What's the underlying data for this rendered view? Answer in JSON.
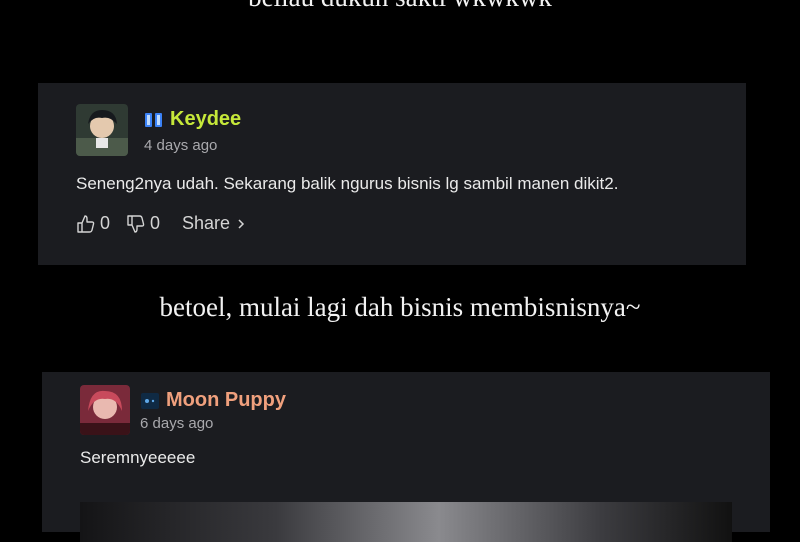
{
  "captions": {
    "top": "beliau dukun sakti wkwkwk",
    "middle": "betoel, mulai lagi dah bisnis membisnisnya~"
  },
  "comments": [
    {
      "username": "Keydee",
      "username_color": "#c6e83a",
      "badge_icon": "rank-badge-icon",
      "timestamp": "4 days ago",
      "text": "Seneng2nya udah. Sekarang balik ngurus bisnis lg sambil manen dikit2.",
      "likes": "0",
      "dislikes": "0",
      "share_label": "Share"
    },
    {
      "username": "Moon Puppy",
      "username_color": "#f0a07d",
      "badge_icon": "rank-badge-icon",
      "timestamp": "6 days ago",
      "text": "Seremnyeeeee"
    }
  ],
  "colors": {
    "background": "#000000",
    "card": "#1b1c20",
    "muted_text": "#a9a9ad"
  }
}
